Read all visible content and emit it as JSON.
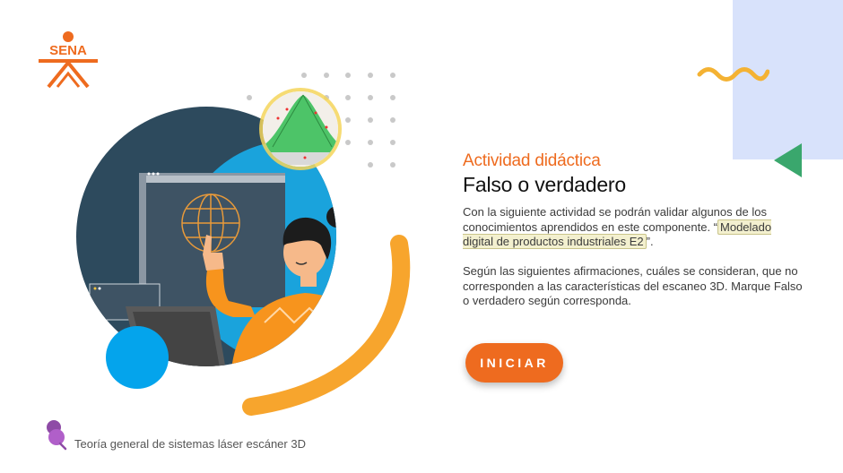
{
  "brand": {
    "logo_text": "SENA"
  },
  "activity": {
    "label": "Actividad didáctica",
    "title": "Falso o verdadero",
    "intro_text": "Con la siguiente actividad se podrán validar algunos de los conocimientos aprendidos en este componente. “",
    "intro_highlight": "Modelado digital de productos industriales E2",
    "intro_end": "”.",
    "instructions": "Según las siguientes afirmaciones, cuáles se consideran, que no corresponden a las características del escaneo 3D. Marque Falso o verdadero según corresponda."
  },
  "start_button": {
    "label": "INICIAR"
  },
  "footer": {
    "course_title": "Teoría general de sistemas láser escáner 3D"
  },
  "colors": {
    "accent_orange": "#ee6b1f",
    "panel_blue": "#d8e2fb",
    "triangle_green": "#3aa76d",
    "squiggle_yellow": "#f4b233"
  },
  "icons": {
    "footer": "pushpin-icon",
    "decor_triangle": "triangle-left-icon",
    "decor_squiggle": "squiggle-icon"
  }
}
